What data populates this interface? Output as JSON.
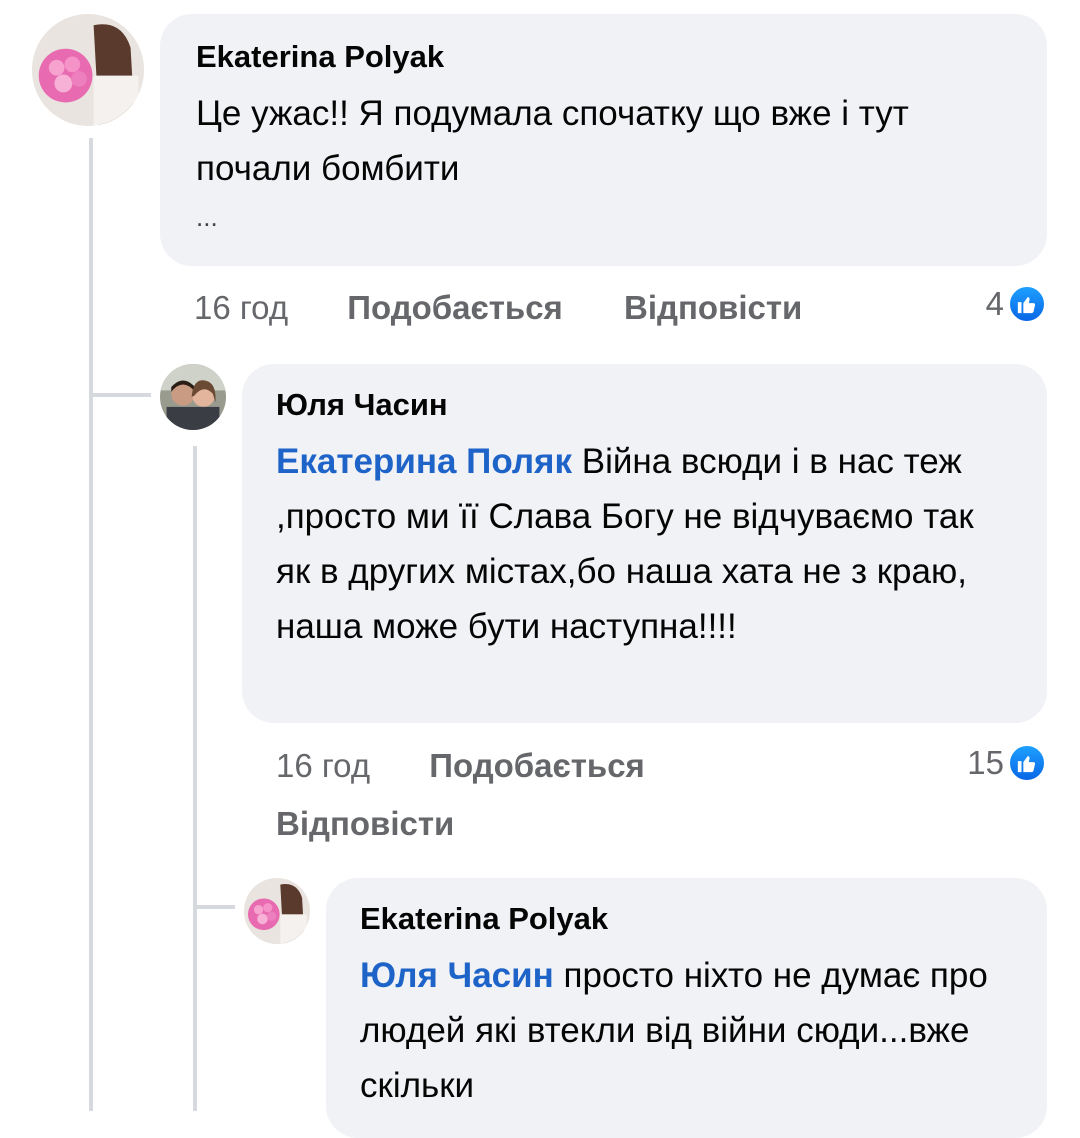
{
  "comments": [
    {
      "author": "Ekaterina Polyak",
      "text": "Це ужас!! Я подумала спочатку що вже і тут почали бомбити",
      "more": "...",
      "time": "16 год",
      "like_label": "Подобається",
      "reply_label": "Відповісти",
      "reaction_count": "4",
      "reaction_icon": "like-icon"
    },
    {
      "author": "Юля Часин",
      "mention": "Екатерина Поляк",
      "text": " Війна всюди і в нас теж ,просто ми її Слава Богу не відчуваємо так як в других містах,бо наша хата не з краю, наша може бути наступна!!!!",
      "time": "16 год",
      "like_label": "Подобається",
      "reply_label": "Відповісти",
      "reaction_count": "15",
      "reaction_icon": "like-icon"
    },
    {
      "author": "Ekaterina Polyak",
      "mention": "Юля Часин",
      "text": " просто ніхто не думає про людей які втекли від війни сюди...вже скільки"
    }
  ],
  "colors": {
    "bubble": "#f0f2f5",
    "mention": "#1d63c8",
    "meta": "#65676b",
    "like_badge": "#1877f2"
  }
}
